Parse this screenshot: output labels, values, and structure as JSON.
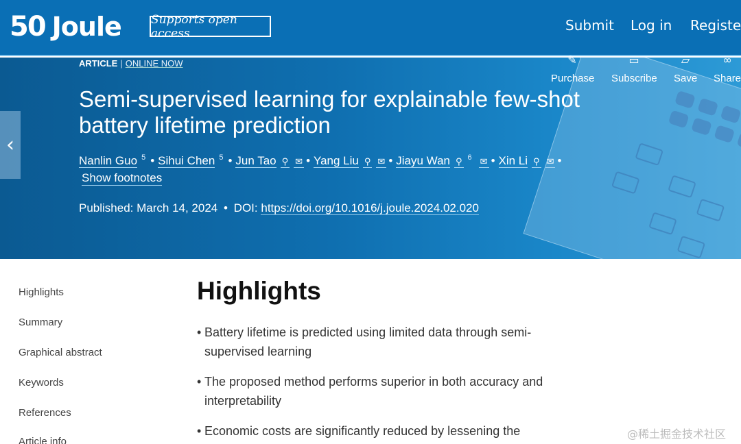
{
  "header": {
    "logo_number": "50",
    "logo_name": "Joule",
    "oa_badge": "Supports open access",
    "nav": [
      "Submit",
      "Log in",
      "Register"
    ]
  },
  "article": {
    "type": "ARTICLE",
    "separator": "|",
    "status": "ONLINE NOW",
    "title": "Semi-supervised learning for explainable few-shot battery lifetime prediction",
    "authors": [
      {
        "name": "Nanlin Guo",
        "sup": "5"
      },
      {
        "name": "Sihui Chen",
        "sup": "5"
      },
      {
        "name": "Jun Tao"
      },
      {
        "name": "Yang Liu"
      },
      {
        "name": "Jiayu Wan",
        "sup": "6"
      },
      {
        "name": "Xin Li"
      }
    ],
    "show_footnotes": "Show footnotes",
    "published": "Published: March 14, 2024",
    "doi_label": "DOI:",
    "doi": "https://doi.org/10.1016/j.joule.2024.02.020",
    "actions": [
      "Purchase",
      "Subscribe",
      "Save",
      "Share"
    ]
  },
  "sidebar": {
    "items": [
      "Highlights",
      "Summary",
      "Graphical abstract",
      "Keywords",
      "References",
      "Article info"
    ]
  },
  "highlights": {
    "heading": "Highlights",
    "items": [
      "Battery lifetime is predicted using limited data through semi-supervised learning",
      "The proposed method performs superior in both accuracy and interpretability",
      "Economic costs are significantly reduced by lessening the"
    ]
  },
  "watermark": "@稀土掘金技术社区",
  "colors": {
    "header_bg": "#0a6fb5",
    "hero_start": "#0b5a92",
    "hero_end": "#2d9ad6"
  }
}
